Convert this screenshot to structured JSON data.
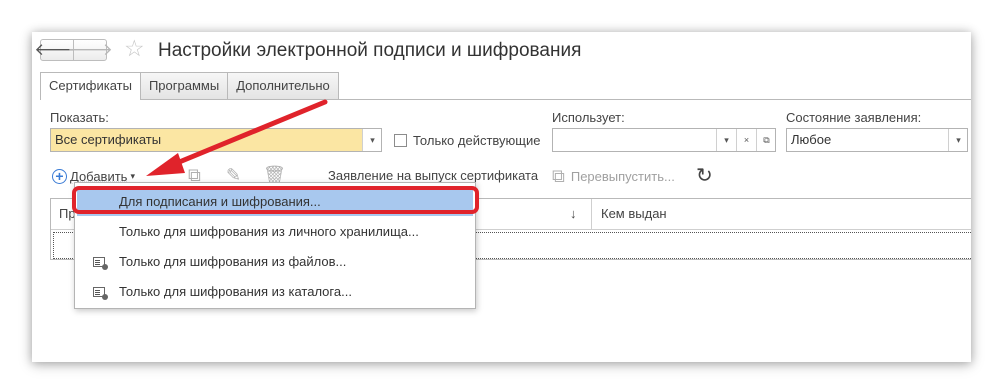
{
  "window": {
    "title": "Настройки электронной подписи и шифрования"
  },
  "nav": {
    "back_icon": "arrow-left-icon",
    "forward_icon": "arrow-right-icon",
    "favorite_icon": "star-icon"
  },
  "tabs": [
    {
      "label": "Сертификаты",
      "active": true
    },
    {
      "label": "Программы",
      "active": false
    },
    {
      "label": "Дополнительно",
      "active": false
    }
  ],
  "filters": {
    "show_label": "Показать:",
    "show_value": "Все сертификаты",
    "only_active_label": "Только действующие",
    "only_active_checked": false,
    "uses_label": "Использует:",
    "uses_value": "",
    "status_label": "Состояние заявления:",
    "status_value": "Любое"
  },
  "toolbar": {
    "add_label": "Добавить",
    "application_label": "Заявление на выпуск сертификата",
    "reissue_label": "Перевыпустить..."
  },
  "table": {
    "columns": [
      {
        "label": "Пр"
      },
      {
        "label": "↓"
      },
      {
        "label": "Кем выдан"
      }
    ]
  },
  "add_menu": {
    "items": [
      {
        "label": "Для подписания и шифрования...",
        "highlighted": true,
        "icon": ""
      },
      {
        "label": "Только для шифрования из личного хранилища...",
        "highlighted": false,
        "icon": ""
      },
      {
        "label": "Только для шифрования из файлов...",
        "highlighted": false,
        "icon": "certificate-icon"
      },
      {
        "label": "Только для шифрования из каталога...",
        "highlighted": false,
        "icon": "certificate-icon"
      }
    ]
  },
  "colors": {
    "highlight": "#a8c8ee",
    "callout_red": "#e0232b",
    "field_yellow": "#fbe6a3",
    "accent_blue": "#3a7bd5"
  }
}
